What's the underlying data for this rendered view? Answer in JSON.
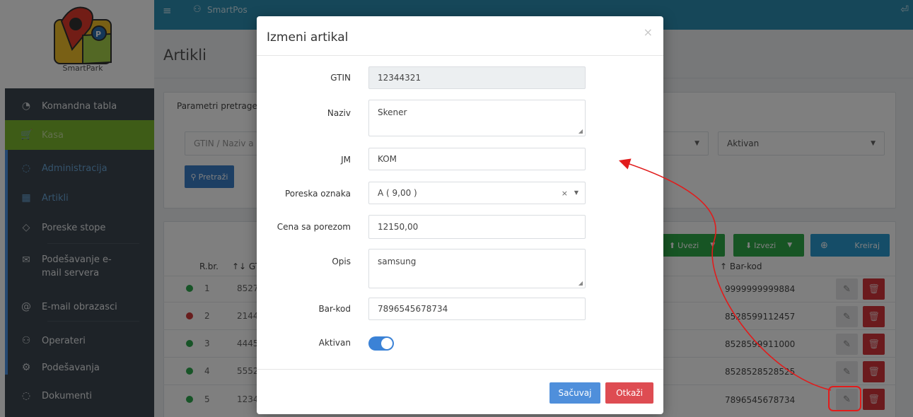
{
  "topbar": {
    "app_title": "SmartPos",
    "menu_icon": "≡",
    "user_icon": "⚇",
    "logout_icon": "⏎"
  },
  "logo": {
    "text": "SmartPark",
    "badge": "P"
  },
  "sidebar": {
    "items": [
      {
        "label": "Komandna tabla",
        "icon": "◔"
      },
      {
        "label": "Kasa",
        "icon": "🛒"
      },
      {
        "label": "Administracija",
        "icon": "◌"
      },
      {
        "label": "Artikli",
        "icon": "▦"
      },
      {
        "label": "Poreske stope",
        "icon": "◇"
      },
      {
        "label": "Podešavanje e-mail servera",
        "icon": "✉"
      },
      {
        "label": "E-mail obrazasci",
        "icon": "@"
      },
      {
        "label": "Operateri",
        "icon": "⚇"
      },
      {
        "label": "Podešavanja",
        "icon": "⚙"
      },
      {
        "label": "Dokumenti",
        "icon": "◌"
      }
    ]
  },
  "page": {
    "title": "Artikli"
  },
  "search": {
    "section_label": "Parametri pretrage",
    "query_placeholder": "GTIN / Naziv a",
    "status_value": "Aktivan",
    "search_button": "Pretraži",
    "search_icon": "⚲"
  },
  "toolbar": {
    "import_label": "Uvezi",
    "export_label": "Izvezi",
    "create_label": "Kreiraj"
  },
  "table": {
    "headers": {
      "rbr": "R.br.",
      "gtin": "↑↓ GT",
      "barcode": "↑ Bar-kod"
    },
    "rows": [
      {
        "num": "1",
        "gtin": "8527",
        "barcode": "9999999999884",
        "status": "active"
      },
      {
        "num": "2",
        "gtin": "2144",
        "barcode": "8528599112457",
        "status": "inactive"
      },
      {
        "num": "3",
        "gtin": "4445",
        "barcode": "8528599911000",
        "status": "active"
      },
      {
        "num": "4",
        "gtin": "5552",
        "barcode": "8528528528525",
        "status": "active"
      },
      {
        "num": "5",
        "gtin": "1234",
        "barcode": "7896545678734",
        "status": "active"
      }
    ],
    "edit_icon": "✎",
    "delete_icon": "🗑"
  },
  "modal": {
    "title": "Izmeni artikal",
    "close": "×",
    "fields": {
      "gtin_label": "GTIN",
      "gtin_value": "12344321",
      "name_label": "Naziv",
      "name_value": "Skener",
      "unit_label": "JM",
      "unit_value": "KOM",
      "tax_label": "Poreska oznaka",
      "tax_value": "A ( 9,00 )",
      "price_label": "Cena sa porezom",
      "price_value": "12150,00",
      "desc_label": "Opis",
      "desc_value": "samsung",
      "barcode_label": "Bar-kod",
      "barcode_value": "7896545678734",
      "active_label": "Aktivan"
    },
    "active": true,
    "save_label": "Sačuvaj",
    "cancel_label": "Otkaži"
  },
  "colors": {
    "topbar": "#2d8fb3",
    "sidebar": "#3c4650",
    "kasa": "#7cb82f",
    "green_button": "#2eaa48",
    "blue_button": "#2a9bd1",
    "delete": "#d6353b",
    "annotation": "#e11c1c"
  }
}
